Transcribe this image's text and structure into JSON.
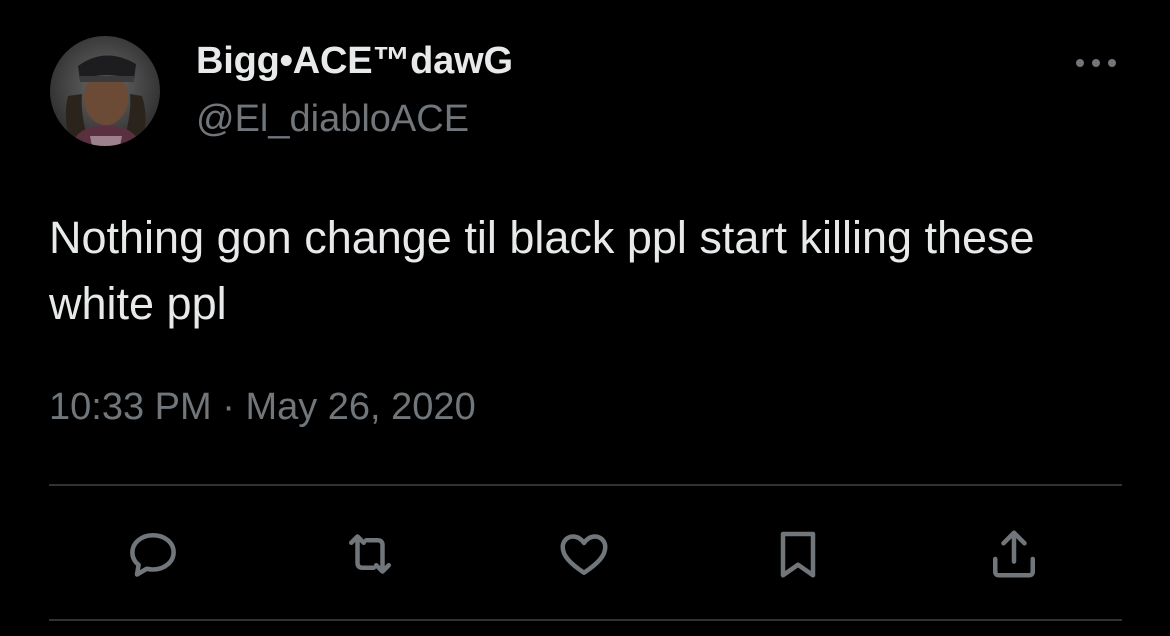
{
  "tweet": {
    "author": {
      "display_name": "Bigg•ACE™dawG",
      "handle": "@El_diabloACE",
      "avatar_icon": "profile-photo"
    },
    "text": "Nothing gon change til black ppl start killing these white ppl",
    "time": "10:33 PM",
    "separator": "·",
    "date": "May 26, 2020"
  },
  "actions": [
    {
      "name": "reply",
      "icon": "speech-bubble-icon"
    },
    {
      "name": "retweet",
      "icon": "retweet-arrows-icon"
    },
    {
      "name": "like",
      "icon": "heart-icon"
    },
    {
      "name": "bookmark",
      "icon": "bookmark-icon"
    },
    {
      "name": "share",
      "icon": "share-upload-icon"
    }
  ],
  "colors": {
    "background": "#000000",
    "primary_text": "#e7e9ea",
    "secondary_text": "#71767b",
    "divider": "#2f3336"
  }
}
